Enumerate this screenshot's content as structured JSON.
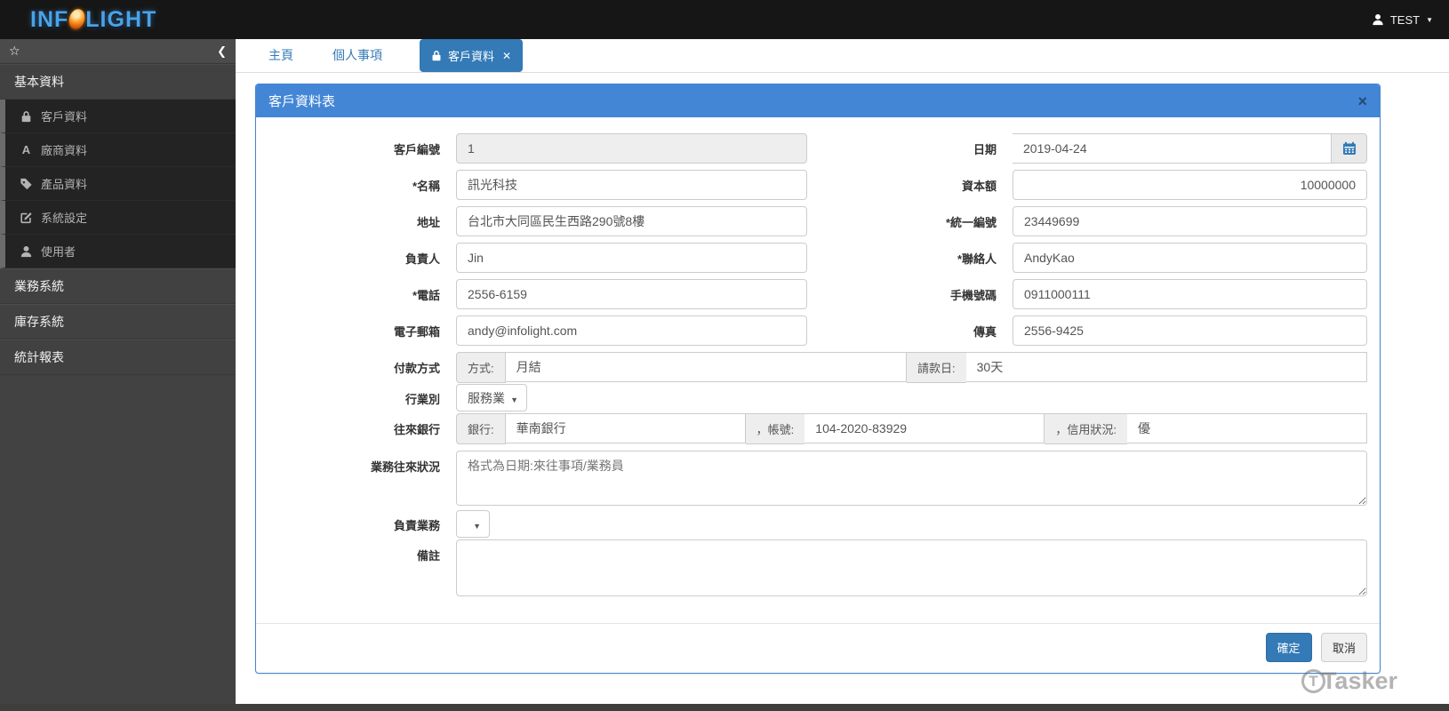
{
  "navbar": {
    "logo_inf": "INF",
    "logo_light": "LIGHT",
    "user_name": "TEST"
  },
  "icons": {
    "star": "☆",
    "collapse": "❮",
    "caret_down": "▼",
    "tab_close": "✕",
    "panel_close": "×",
    "vendor_letter": "A"
  },
  "sidebar": {
    "sections": [
      {
        "label": "基本資料"
      },
      {
        "label": "業務系統"
      },
      {
        "label": "庫存系統"
      },
      {
        "label": "統計報表"
      }
    ],
    "items": [
      {
        "label": "客戶資料"
      },
      {
        "label": "廠商資料"
      },
      {
        "label": "產品資料"
      },
      {
        "label": "系統設定"
      },
      {
        "label": "使用者"
      }
    ]
  },
  "tabs": {
    "home": "主頁",
    "personal": "個人事項",
    "customer": "客戶資料"
  },
  "panel": {
    "title": "客戶資料表"
  },
  "form": {
    "customer_id": {
      "label": "客戶編號",
      "value": "1"
    },
    "date": {
      "label": "日期",
      "value": "2019-04-24"
    },
    "name": {
      "label": "*名稱",
      "value": "訊光科技"
    },
    "capital": {
      "label": "資本額",
      "value": "10000000"
    },
    "address": {
      "label": "地址",
      "value": "台北市大同區民生西路290號8樓"
    },
    "tax_id": {
      "label": "*統一編號",
      "value": "23449699"
    },
    "owner": {
      "label": "負責人",
      "value": "Jin"
    },
    "contact": {
      "label": "*聯絡人",
      "value": "AndyKao"
    },
    "phone": {
      "label": "*電話",
      "value": "2556-6159"
    },
    "mobile": {
      "label": "手機號碼",
      "value": "0911000111"
    },
    "email": {
      "label": "電子郵箱",
      "value": "andy@infolight.com"
    },
    "fax": {
      "label": "傳真",
      "value": "2556-9425"
    },
    "payment": {
      "label": "付款方式",
      "method_addon": "方式:",
      "method_value": "月結",
      "day_addon": "請款日:",
      "day_value": "30天"
    },
    "industry": {
      "label": "行業別",
      "value": "服務業"
    },
    "bank": {
      "label": "往來銀行",
      "bank_addon": "銀行:",
      "bank_value": "華南銀行",
      "account_addon": "，帳號:",
      "account_value": "104-2020-83929",
      "credit_addon": "，信用狀況:",
      "credit_value": "優"
    },
    "business_status": {
      "label": "業務往來狀況",
      "placeholder": "格式為日期:來往事項/業務員",
      "value": ""
    },
    "sales_rep": {
      "label": "負責業務",
      "value": ""
    },
    "remark": {
      "label": "備註",
      "value": ""
    }
  },
  "footer": {
    "ok": "確定",
    "cancel": "取消"
  },
  "watermark": {
    "initial": "T",
    "text": "Tasker"
  }
}
